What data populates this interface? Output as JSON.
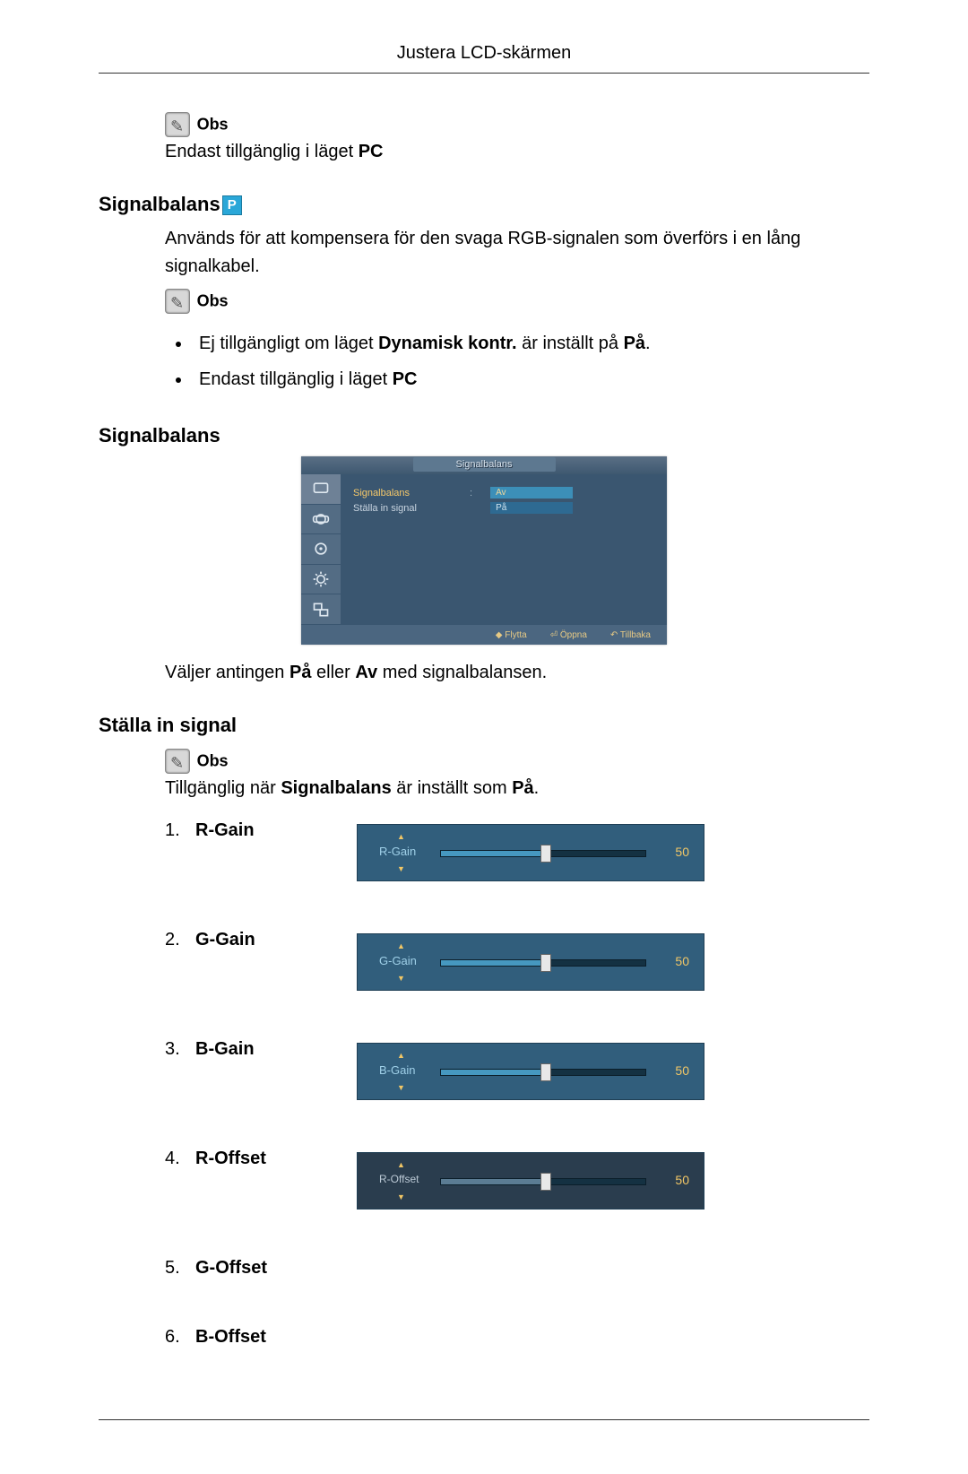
{
  "header": {
    "title": "Justera LCD-skärmen"
  },
  "obs_label": "Obs",
  "section1": {
    "note_text_prefix": "Endast tillgänglig i läget ",
    "note_text_bold": "PC"
  },
  "section2": {
    "heading": "Signalbalans",
    "intro": "Används för att kompensera för den svaga RGB-signalen som överförs i en lång signalkabel.",
    "bullets": [
      {
        "pre": "Ej tillgängligt om läget ",
        "b1": "Dynamisk kontr.",
        "mid": " är inställt på ",
        "b2": "På",
        "post": "."
      },
      {
        "pre": "Endast tillgänglig i läget ",
        "b1": "PC",
        "mid": "",
        "b2": "",
        "post": ""
      }
    ]
  },
  "section3": {
    "heading": "Signalbalans",
    "osd": {
      "title": "Signalbalans",
      "row1_label": "Signalbalans",
      "row1_value": "Av",
      "row2_label": "Ställa in signal",
      "row2_value": "På",
      "footer": {
        "move": "Flytta",
        "open": "Öppna",
        "back": "Tillbaka"
      }
    },
    "caption_pre": "Väljer antingen ",
    "caption_b1": "På",
    "caption_mid": " eller ",
    "caption_b2": "Av",
    "caption_post": " med signalbalansen."
  },
  "section4": {
    "heading": "Ställa in signal",
    "note_pre": "Tillgänglig när ",
    "note_b1": "Signalbalans",
    "note_mid": " är inställt som ",
    "note_b2": "På",
    "note_post": ".",
    "items": [
      {
        "n": "1.",
        "name": "R-Gain",
        "label": "R-Gain",
        "value": "50",
        "has_image": true,
        "dark": false
      },
      {
        "n": "2.",
        "name": "G-Gain",
        "label": "G-Gain",
        "value": "50",
        "has_image": true,
        "dark": false
      },
      {
        "n": "3.",
        "name": "B-Gain",
        "label": "B-Gain",
        "value": "50",
        "has_image": true,
        "dark": false
      },
      {
        "n": "4.",
        "name": "R-Offset",
        "label": "R-Offset",
        "value": "50",
        "has_image": true,
        "dark": true
      },
      {
        "n": "5.",
        "name": "G-Offset",
        "label": "",
        "value": "",
        "has_image": false,
        "dark": false
      },
      {
        "n": "6.",
        "name": "B-Offset",
        "label": "",
        "value": "",
        "has_image": false,
        "dark": false
      }
    ]
  }
}
